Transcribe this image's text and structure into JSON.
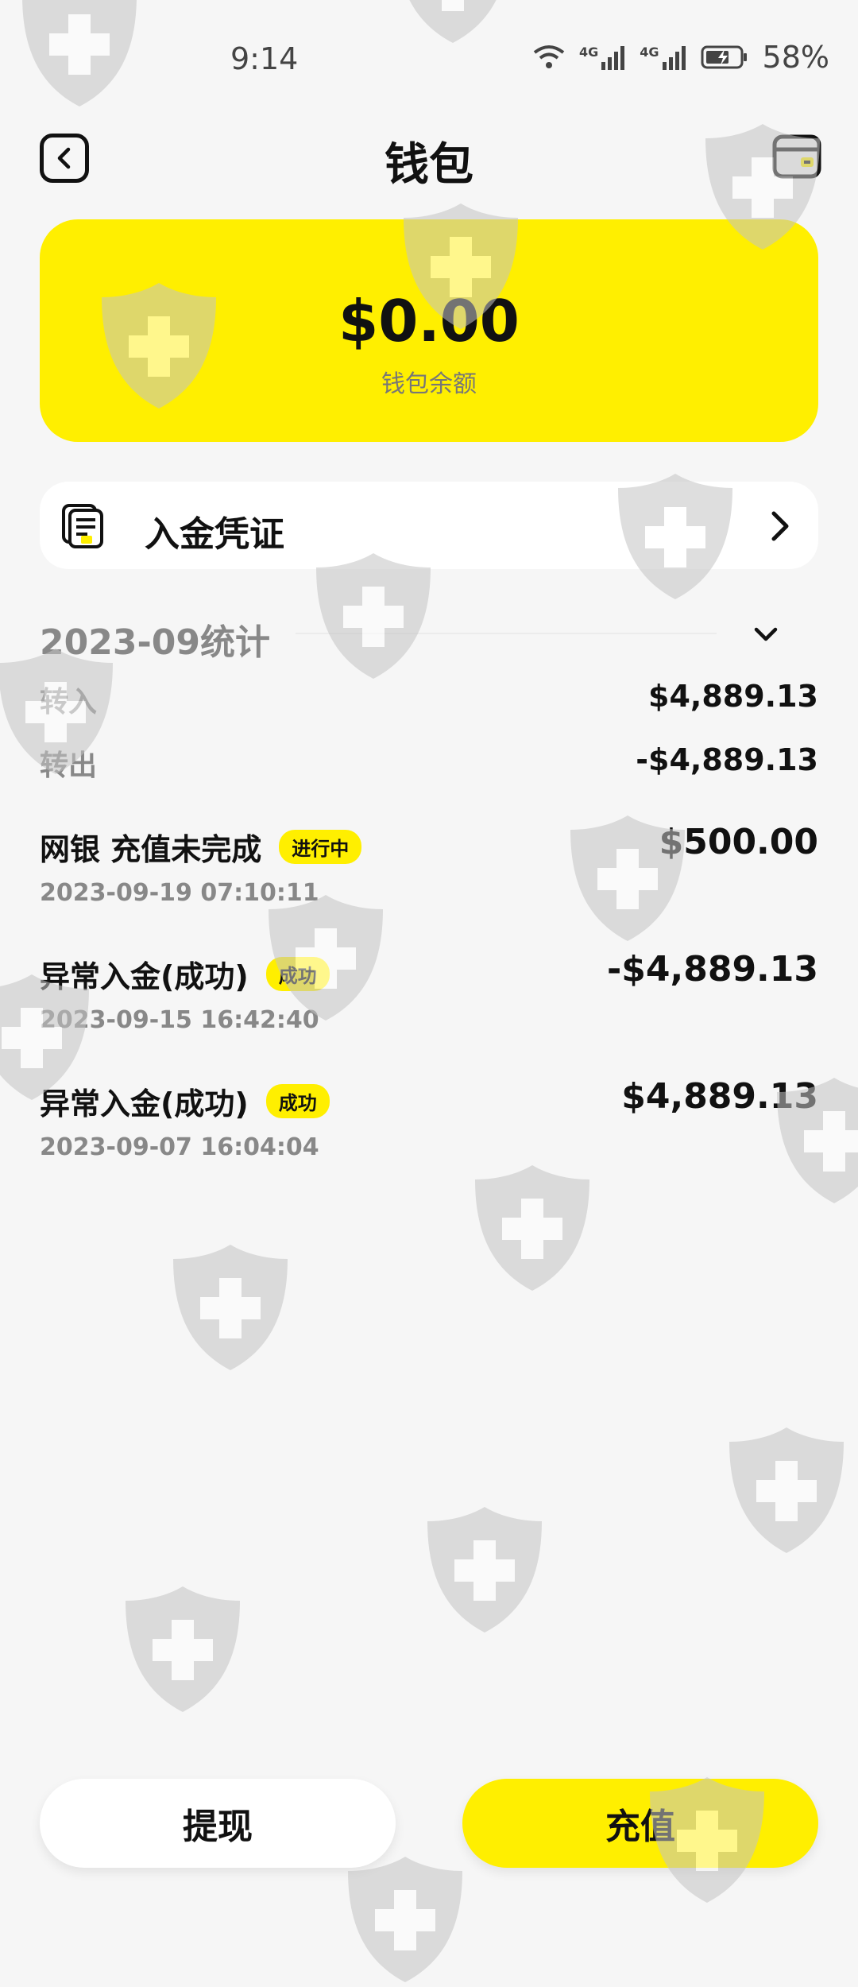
{
  "status_bar": {
    "time": "9:14",
    "network_1": "4G",
    "network_2": "4G",
    "battery": "58%"
  },
  "header": {
    "title": "钱包"
  },
  "balance": {
    "amount": "$0.00",
    "label": "钱包余额"
  },
  "voucher": {
    "label": "入金凭证"
  },
  "stats": {
    "title": "2023-09统计",
    "rows": [
      {
        "label": "转入",
        "value": "$4,889.13"
      },
      {
        "label": "转出",
        "value": "-$4,889.13"
      }
    ]
  },
  "transactions": [
    {
      "title": "网银 充值未完成",
      "badge": "进行中",
      "date": "2023-09-19 07:10:11",
      "amount": "$500.00"
    },
    {
      "title": "异常入金(成功)",
      "badge": "成功",
      "date": "2023-09-15 16:42:40",
      "amount": "-$4,889.13"
    },
    {
      "title": "异常入金(成功)",
      "badge": "成功",
      "date": "2023-09-07 16:04:04",
      "amount": "$4,889.13"
    }
  ],
  "buttons": {
    "withdraw": "提现",
    "recharge": "充值"
  },
  "colors": {
    "accent": "#ffef00",
    "background": "#f6f6f6",
    "muted_text": "#888888"
  }
}
